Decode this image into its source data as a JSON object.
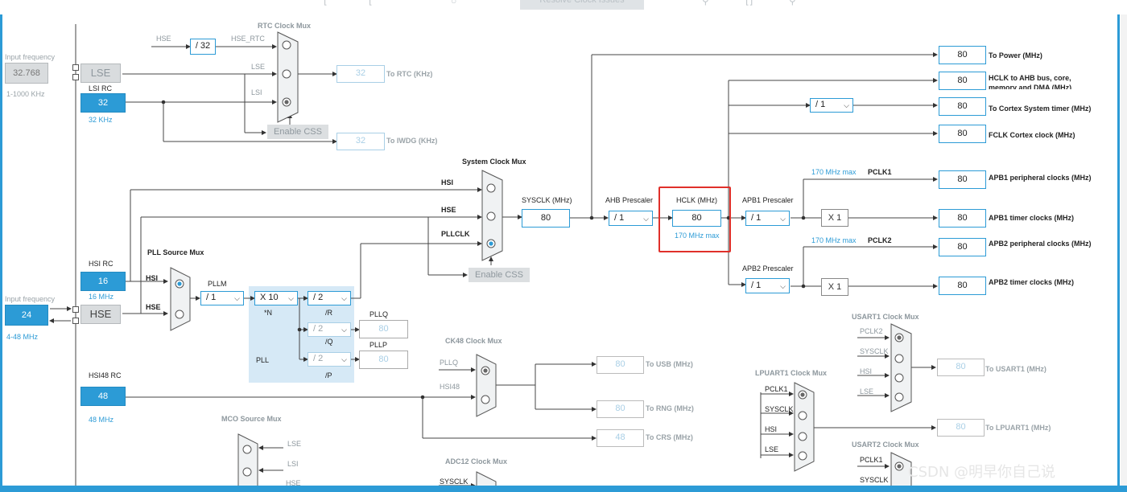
{
  "toolbar": {
    "resolve_label": "Resolve Clock Issues"
  },
  "input_lse": {
    "title": "Input frequency",
    "value": "32.768",
    "range": "1-1000 KHz"
  },
  "input_hse": {
    "title": "Input frequency",
    "value": "24",
    "range": "4-48 MHz"
  },
  "rtc_mux": {
    "title": "RTC Clock Mux",
    "hse": "HSE",
    "div": "/ 32",
    "hse_rtc": "HSE_RTC",
    "lse": "LSE",
    "lsi": "LSI",
    "out_value": "32",
    "out_label": "To RTC (KHz)"
  },
  "lse": {
    "label": "LSE"
  },
  "lsi_rc": {
    "label": "LSI RC",
    "value": "32",
    "unit": "32 KHz"
  },
  "enable_css_1": "Enable CSS",
  "iwdg": {
    "value": "32",
    "label": "To IWDG (KHz)"
  },
  "sysclk_mux": {
    "title": "System Clock Mux",
    "hsi": "HSI",
    "hse": "HSE",
    "pllclk": "PLLCLK",
    "enable_css": "Enable CSS"
  },
  "sysclk": {
    "label": "SYSCLK (MHz)",
    "value": "80"
  },
  "ahb": {
    "label": "AHB Prescaler",
    "value": "/ 1"
  },
  "hclk": {
    "label": "HCLK (MHz)",
    "value": "80",
    "max": "170 MHz max"
  },
  "apb1": {
    "label": "APB1 Prescaler",
    "value": "/ 1",
    "max": "170 MHz max",
    "pclk": "PCLK1",
    "mult": "X 1"
  },
  "apb2": {
    "label": "APB2 Prescaler",
    "value": "/ 1",
    "max": "170 MHz max",
    "pclk": "PCLK2",
    "mult": "X 1"
  },
  "cortex_div": "/ 1",
  "outputs": [
    {
      "value": "80",
      "label": "To Power (MHz)"
    },
    {
      "value": "80",
      "label": "HCLK to AHB bus, core, memory and DMA (MHz)"
    },
    {
      "value": "80",
      "label": "To Cortex System timer (MHz)"
    },
    {
      "value": "80",
      "label": "FCLK Cortex clock (MHz)"
    },
    {
      "value": "80",
      "label": "APB1 peripheral clocks (MHz)"
    },
    {
      "value": "80",
      "label": "APB1 timer clocks (MHz)"
    },
    {
      "value": "80",
      "label": "APB2 peripheral clocks (MHz)"
    },
    {
      "value": "80",
      "label": "APB2 timer clocks (MHz)"
    }
  ],
  "hsi_rc": {
    "label": "HSI RC",
    "value": "16",
    "unit": "16 MHz"
  },
  "hse": {
    "label": "HSE"
  },
  "pll_src": {
    "title": "PLL Source Mux",
    "hsi": "HSI",
    "hse": "HSE"
  },
  "pll": {
    "pllm_label": "PLLM",
    "pllm": "/ 1",
    "muln": "X 10",
    "n_label": "*N",
    "divr": "/ 2",
    "r_label": "/R",
    "divq": "/ 2",
    "q_label": "/Q",
    "divp": "/ 2",
    "p_label": "/P",
    "pll_label": "PLL",
    "pllq_label": "PLLQ",
    "pllq_value": "80",
    "pllp_label": "PLLP",
    "pllp_value": "80"
  },
  "hsi48_rc": {
    "label": "HSI48 RC",
    "value": "48",
    "unit": "48 MHz"
  },
  "ck48": {
    "title": "CK48 Clock Mux",
    "pllq": "PLLQ",
    "hsi48": "HSI48",
    "usb_value": "80",
    "usb_label": "To USB (MHz)",
    "rng_value": "80",
    "rng_label": "To RNG (MHz)",
    "crs_value": "48",
    "crs_label": "To CRS (MHz)"
  },
  "mco": {
    "title": "MCO Source Mux",
    "lse": "LSE",
    "lsi": "LSI",
    "hse": "HSE"
  },
  "adc12": {
    "title": "ADC12 Clock Mux",
    "sysclk": "SYSCLK"
  },
  "usart1": {
    "title": "USART1 Clock Mux",
    "pclk2": "PCLK2",
    "sysclk": "SYSCLK",
    "hsi": "HSI",
    "lse": "LSE",
    "value": "80",
    "label": "To USART1 (MHz)"
  },
  "lpuart1": {
    "title": "LPUART1 Clock Mux",
    "pclk1": "PCLK1",
    "sysclk": "SYSCLK",
    "hsi": "HSI",
    "lse": "LSE",
    "value": "80",
    "label": "To LPUART1 (MHz)"
  },
  "usart2": {
    "title": "USART2 Clock Mux",
    "pclk1": "PCLK1",
    "sysclk": "SYSCLK"
  },
  "watermark": "CSDN @明早你自己说",
  "colors": {
    "accent": "#2c9bd6",
    "highlight": "#e0302a",
    "pll_bg": "#d6e9f6"
  }
}
